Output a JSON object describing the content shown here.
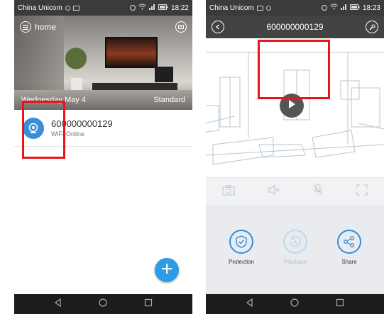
{
  "left_phone": {
    "status": {
      "carrier": "China Unicom",
      "time": "18:22",
      "icons": [
        "sim-icon",
        "alarm-icon",
        "wifi-icon",
        "signal-icon",
        "battery-icon"
      ]
    },
    "hero": {
      "home_label": "home",
      "date": "Wednesday May 4",
      "mode": "Standard"
    },
    "device": {
      "name": "600000000129",
      "status": "WiFi-Online"
    },
    "fab_icon": "plus-icon"
  },
  "right_phone": {
    "status": {
      "carrier": "China Unicom",
      "time": "18:23"
    },
    "title": "600000000129",
    "controls": [
      "camera-icon",
      "mute-icon",
      "mic-off-icon",
      "fullscreen-icon"
    ],
    "functions": [
      {
        "label": "Protection",
        "icon": "shield-check-icon",
        "enabled": true
      },
      {
        "label": "Playback",
        "icon": "history-icon",
        "enabled": false
      },
      {
        "label": "Share",
        "icon": "share-icon",
        "enabled": true
      }
    ]
  },
  "colors": {
    "accent": "#2d8fe0",
    "highlight": "#e8141b",
    "status_bar": "#3b3b3b",
    "nav_bar": "#1c1c1c"
  }
}
